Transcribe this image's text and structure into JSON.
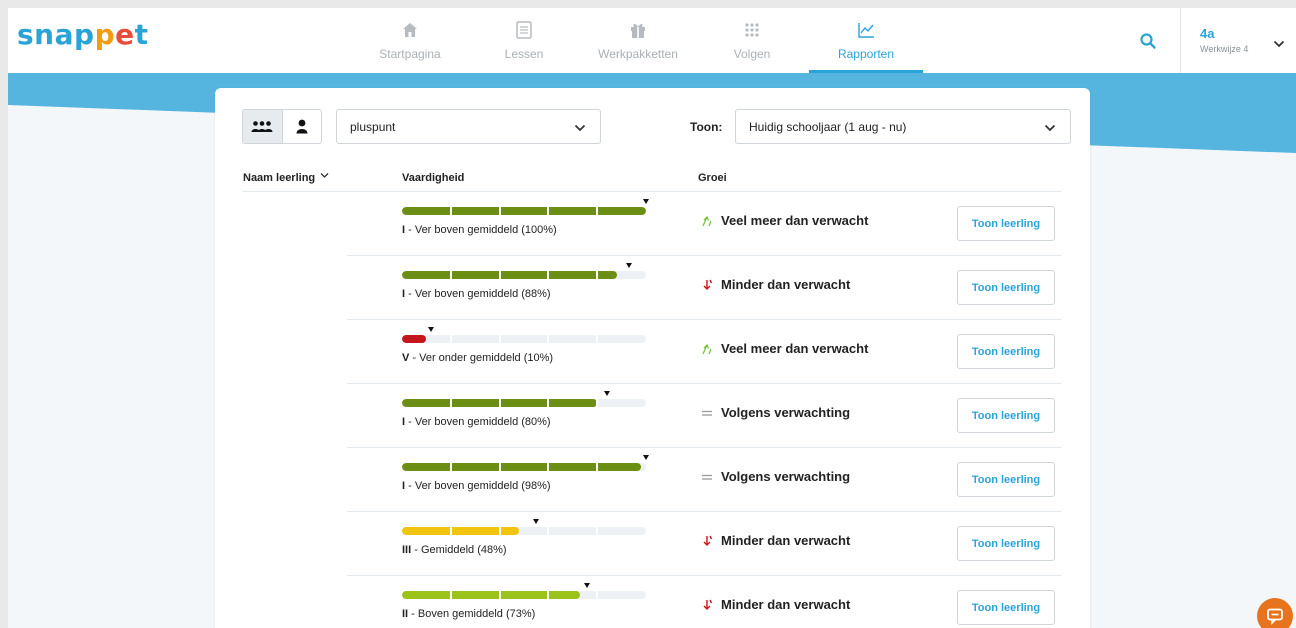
{
  "logo": {
    "letters": [
      "s",
      "n",
      "a",
      "p",
      "p",
      "e",
      "t"
    ],
    "colors": [
      "#2aa3d6",
      "#2aa3d6",
      "#2aa3d6",
      "#2aa3d6",
      "#f39c12",
      "#e74c3c",
      "#2aa3d6"
    ]
  },
  "nav": {
    "items": [
      {
        "label": "Startpagina",
        "icon": "home-icon"
      },
      {
        "label": "Lessen",
        "icon": "document-icon"
      },
      {
        "label": "Werkpakketten",
        "icon": "gift-icon"
      },
      {
        "label": "Volgen",
        "icon": "grid-icon"
      },
      {
        "label": "Rapporten",
        "icon": "chart-icon",
        "active": true
      }
    ]
  },
  "group": {
    "name": "4a",
    "subtitle": "Werkwijze 4"
  },
  "filters": {
    "subject": "pluspunt",
    "period_label": "Toon:",
    "period": "Huidig schooljaar (1 aug - nu)"
  },
  "table": {
    "headers": {
      "name": "Naam leerling",
      "skill": "Vaardigheid",
      "growth": "Groei"
    },
    "button_label": "Toon leerling",
    "rows": [
      {
        "level": "I",
        "desc": " - Ver boven gemiddeld (100%)",
        "pct": 100,
        "marker": 100,
        "color": "#6b8e14",
        "growth": "Veel meer dan verwacht",
        "trend": "up"
      },
      {
        "level": "I",
        "desc": " - Ver boven gemiddeld (88%)",
        "pct": 88,
        "marker": 93,
        "color": "#6b8e14",
        "growth": "Minder dan verwacht",
        "trend": "down"
      },
      {
        "level": "V",
        "desc": " - Ver onder gemiddeld (10%)",
        "pct": 10,
        "marker": 12,
        "color": "#c4161c",
        "growth": "Veel meer dan verwacht",
        "trend": "up"
      },
      {
        "level": "I",
        "desc": " - Ver boven gemiddeld (80%)",
        "pct": 80,
        "marker": 84,
        "color": "#6b8e14",
        "growth": "Volgens verwachting",
        "trend": "equal"
      },
      {
        "level": "I",
        "desc": " - Ver boven gemiddeld (98%)",
        "pct": 98,
        "marker": 100,
        "color": "#6b8e14",
        "growth": "Volgens verwachting",
        "trend": "equal"
      },
      {
        "level": "III",
        "desc": " - Gemiddeld (48%)",
        "pct": 48,
        "marker": 55,
        "color": "#f1c40f",
        "growth": "Minder dan verwacht",
        "trend": "down"
      },
      {
        "level": "II",
        "desc": " - Boven gemiddeld (73%)",
        "pct": 73,
        "marker": 76,
        "color": "#9ac31c",
        "growth": "Minder dan verwacht",
        "trend": "down"
      }
    ]
  },
  "colors": {
    "accent": "#2aa3d6",
    "up": "#7cc242",
    "down": "#c4161c",
    "equal": "#999999",
    "chat": "#e8731f"
  }
}
